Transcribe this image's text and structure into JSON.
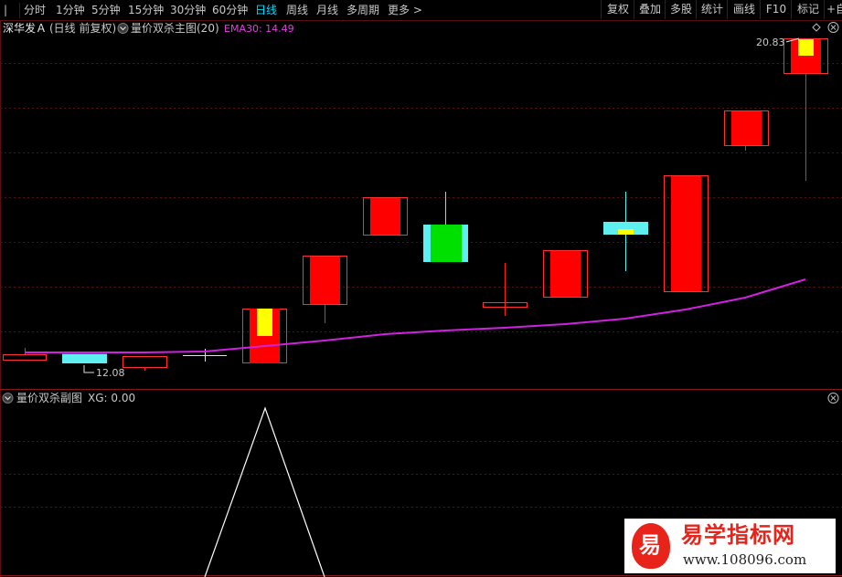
{
  "toolbar": {
    "periods": [
      "分时",
      "1分钟",
      "5分钟",
      "15分钟",
      "30分钟",
      "60分钟",
      "日线",
      "周线",
      "月线",
      "多周期"
    ],
    "active_period": "日线",
    "more_label": "更多 >",
    "right_buttons": [
      "复权",
      "叠加",
      "多股",
      "统计",
      "画线",
      "F10",
      "标记"
    ],
    "edge_label": "+自"
  },
  "main_panel": {
    "stock_name": "深华发Ａ",
    "mode": "(日线 前复权)",
    "indicator_name": "量价双杀主图(20)",
    "ema_label": "EMA30: 14.49",
    "high_label": "20.83",
    "low_label": "12.08"
  },
  "sub_panel": {
    "indicator_name": "量价双杀副图",
    "xg_label": "XG: 0.00"
  },
  "watermark": {
    "glyph": "易",
    "title": "易学指标网",
    "url": "www.108096.com"
  },
  "colors": {
    "up": "#ff0000",
    "down_fill_green": "#00e000",
    "cyan": "#5ef0f0",
    "yellow": "#ffff00",
    "ema": "#d020e0",
    "grid": "#5a1010"
  }
}
